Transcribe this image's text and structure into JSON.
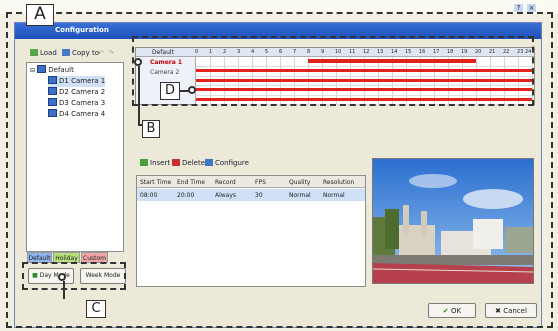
{
  "window": {
    "title": "Configuration"
  },
  "toolbar": {
    "load": "Load",
    "copy_to": "Copy to"
  },
  "tree": {
    "root": "Default",
    "cameras": [
      "D1 Camera 1",
      "D2 Camera 2",
      "D3 Camera 3",
      "D4 Camera 4"
    ]
  },
  "tabs": {
    "default": "Default",
    "holiday": "Holiday",
    "custom": "Custom"
  },
  "modes": {
    "day": "Day Mode",
    "week": "Week Mode"
  },
  "schedule_grid": {
    "header": "Default",
    "hours": [
      "0",
      "1",
      "2",
      "3",
      "4",
      "5",
      "6",
      "7",
      "8",
      "9",
      "10",
      "11",
      "12",
      "13",
      "14",
      "15",
      "16",
      "17",
      "18",
      "19",
      "20",
      "21",
      "22",
      "23",
      "24"
    ],
    "rows": [
      "Camera 1",
      "Camera 2",
      "",
      "",
      ""
    ]
  },
  "actions": {
    "insert": "Insert",
    "delete": "Delete",
    "configure": "Configure"
  },
  "table": {
    "headers": [
      "Start Time",
      "End Time",
      "Record",
      "FPS",
      "Quality",
      "Resolution"
    ],
    "rows": [
      [
        "08:00",
        "20:00",
        "Always",
        "30",
        "Normal",
        "Normal"
      ]
    ]
  },
  "buttons": {
    "ok": "OK",
    "cancel": "Cancel"
  },
  "callouts": {
    "a": "A",
    "b": "B",
    "c": "C",
    "d": "D"
  },
  "colors": {
    "schedule_bar": "#e0241b",
    "titlebar": "#2457c5",
    "selection": "#cfe0f7"
  }
}
